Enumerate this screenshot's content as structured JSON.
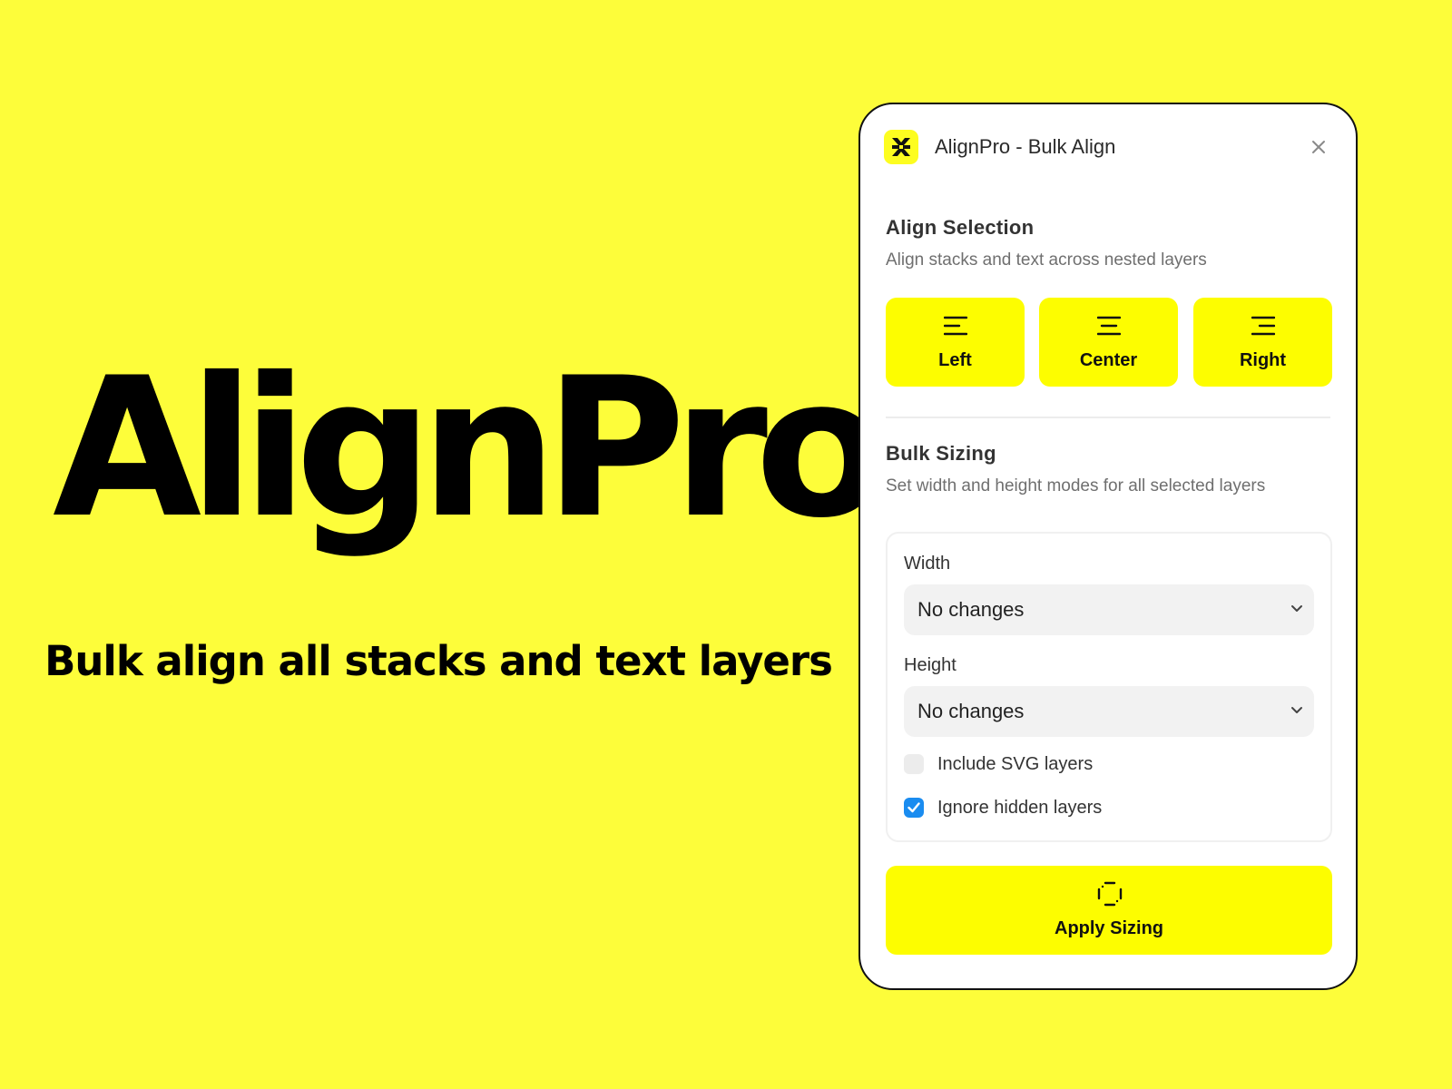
{
  "hero": {
    "title": "AlignPro",
    "subtitle": "Bulk align all stacks and text layers"
  },
  "panel": {
    "title": "AlignPro - Bulk Align",
    "logo_icon": "alignpro-logo-icon",
    "close_icon": "close-icon"
  },
  "align_section": {
    "title": "Align Selection",
    "description": "Align stacks and text across nested layers",
    "buttons": [
      {
        "label": "Left",
        "icon": "align-left-icon"
      },
      {
        "label": "Center",
        "icon": "align-center-icon"
      },
      {
        "label": "Right",
        "icon": "align-right-icon"
      }
    ]
  },
  "sizing_section": {
    "title": "Bulk Sizing",
    "description": "Set width and height modes for all selected layers",
    "width": {
      "label": "Width",
      "value": "No changes"
    },
    "height": {
      "label": "Height",
      "value": "No changes"
    },
    "options": [
      {
        "label": "Include SVG layers",
        "checked": false
      },
      {
        "label": "Ignore hidden layers",
        "checked": true
      }
    ],
    "apply": {
      "label": "Apply Sizing",
      "icon": "resize-frame-icon"
    }
  },
  "colors": {
    "background": "#fdfd3a",
    "accent": "#fdfd00",
    "checkbox_on": "#1a8cf0"
  }
}
